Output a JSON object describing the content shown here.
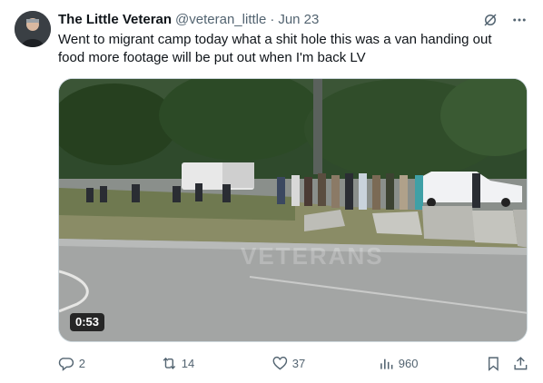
{
  "tweet": {
    "display_name": "The Little Veteran",
    "handle": "@veteran_little",
    "separator": "·",
    "date": "Jun 23",
    "text": "Went to migrant camp today what a shit hole this was a van handing out food more footage will be put out when I'm back LV"
  },
  "media": {
    "duration": "0:53",
    "watermark": "VETERANS"
  },
  "actions": {
    "replies": "2",
    "reposts": "14",
    "likes": "37",
    "views": "960"
  },
  "icons": {
    "header": [
      "grok-icon",
      "more-icon"
    ],
    "actions": [
      "reply-icon",
      "repost-icon",
      "like-icon",
      "views-icon",
      "bookmark-icon",
      "share-icon"
    ]
  },
  "colors": {
    "text_primary": "#0f1419",
    "text_secondary": "#536471",
    "border": "#cfd9de"
  }
}
